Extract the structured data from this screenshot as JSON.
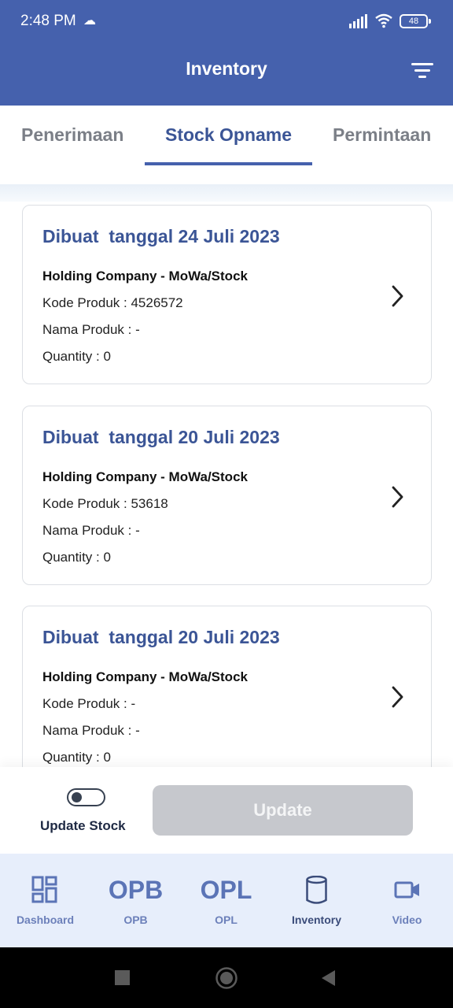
{
  "status_bar": {
    "time": "2:48 PM",
    "battery": "48"
  },
  "header": {
    "title": "Inventory"
  },
  "tabs": [
    {
      "label": "Penerimaan"
    },
    {
      "label": "Stock Opname"
    },
    {
      "label": "Permintaan"
    }
  ],
  "cards": [
    {
      "heading": "Dibuat  tanggal 24 Juli 2023",
      "company": "Holding Company - MoWa/Stock",
      "kode": "Kode Produk : 4526572",
      "nama": "Nama Produk : -",
      "quantity": "Quantity : 0"
    },
    {
      "heading": "Dibuat  tanggal 20 Juli 2023",
      "company": "Holding Company - MoWa/Stock",
      "kode": "Kode Produk : 53618",
      "nama": "Nama Produk : -",
      "quantity": "Quantity : 0"
    },
    {
      "heading": "Dibuat  tanggal 20 Juli 2023",
      "company": "Holding Company - MoWa/Stock",
      "kode": "Kode Produk : -",
      "nama": "Nama Produk : -",
      "quantity": "Quantity : 0"
    }
  ],
  "actions": {
    "toggle_label": "Update Stock",
    "toggle_on": false,
    "update_label": "Update"
  },
  "bottom_nav": [
    {
      "label": "Dashboard",
      "icon": "dashboard-icon"
    },
    {
      "label": "OPB",
      "icon_text": "OPB"
    },
    {
      "label": "OPL",
      "icon_text": "OPL"
    },
    {
      "label": "Inventory",
      "icon": "database-icon"
    },
    {
      "label": "Video",
      "icon": "video-camera-icon"
    }
  ],
  "colors": {
    "primary": "#4561ad",
    "accent_text": "#3b5596",
    "nav_bg": "#e7eefb",
    "disabled_button": "#c6c8cd"
  }
}
